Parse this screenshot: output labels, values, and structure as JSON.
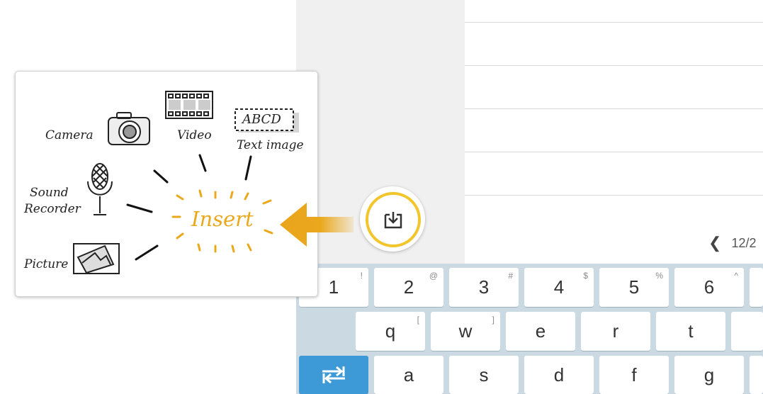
{
  "insert_illustration": {
    "camera_label": "Camera",
    "video_label": "Video",
    "text_image_label": "Text image",
    "text_image_sample": "ABCD",
    "sound_label_line1": "Sound",
    "sound_label_line2": "Recorder",
    "picture_label": "Picture",
    "insert_label": "Insert",
    "accent_color": "#eaa81d"
  },
  "page_indicator": {
    "text": "12/2"
  },
  "keyboard": {
    "number_row": [
      {
        "label": "1",
        "alt": "!"
      },
      {
        "label": "2",
        "alt": "@"
      },
      {
        "label": "3",
        "alt": "#"
      },
      {
        "label": "4",
        "alt": "$"
      },
      {
        "label": "5",
        "alt": "%"
      },
      {
        "label": "6",
        "alt": "^"
      }
    ],
    "q_row": [
      {
        "label": "q",
        "alt": "["
      },
      {
        "label": "w",
        "alt": "]"
      },
      {
        "label": "e",
        "alt": ""
      },
      {
        "label": "r",
        "alt": ""
      },
      {
        "label": "t",
        "alt": ""
      }
    ],
    "a_row": [
      "a",
      "s",
      "d",
      "f",
      "g"
    ],
    "tab_color": "#3d9ad7"
  }
}
